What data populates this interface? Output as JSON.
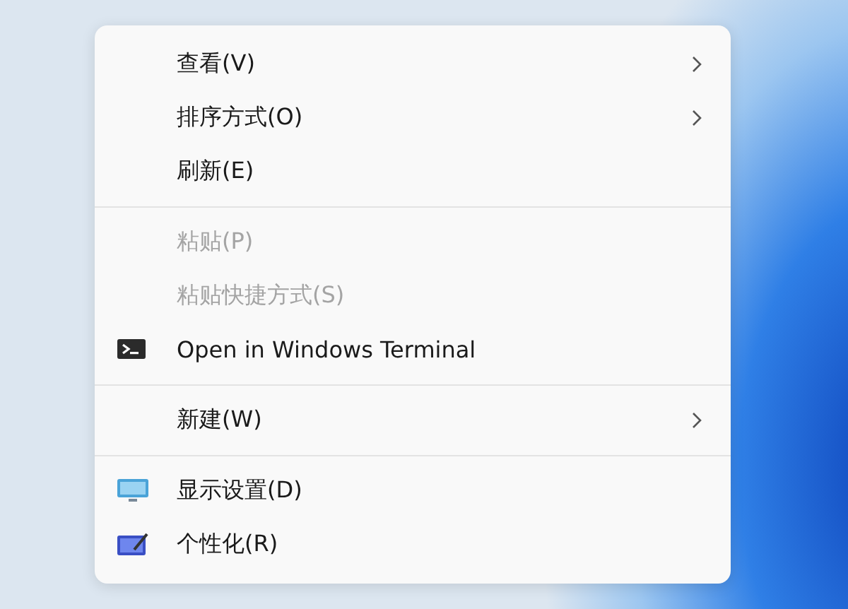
{
  "context_menu": {
    "groups": [
      {
        "items": [
          {
            "label": "查看(V)",
            "disabled": false,
            "submenu": true,
            "kind": "plain"
          },
          {
            "label": "排序方式(O)",
            "disabled": false,
            "submenu": true,
            "kind": "plain"
          },
          {
            "label": "刷新(E)",
            "disabled": false,
            "submenu": false,
            "kind": "plain"
          }
        ]
      },
      {
        "items": [
          {
            "label": "粘贴(P)",
            "disabled": true,
            "submenu": false,
            "kind": "plain"
          },
          {
            "label": "粘贴快捷方式(S)",
            "disabled": true,
            "submenu": false,
            "kind": "plain"
          },
          {
            "label": "Open in Windows Terminal",
            "disabled": false,
            "submenu": false,
            "kind": "terminal"
          }
        ]
      },
      {
        "items": [
          {
            "label": "新建(W)",
            "disabled": false,
            "submenu": true,
            "kind": "plain"
          }
        ]
      },
      {
        "items": [
          {
            "label": "显示设置(D)",
            "disabled": false,
            "submenu": false,
            "kind": "display"
          },
          {
            "label": "个性化(R)",
            "disabled": false,
            "submenu": false,
            "kind": "personalize"
          }
        ]
      }
    ]
  }
}
